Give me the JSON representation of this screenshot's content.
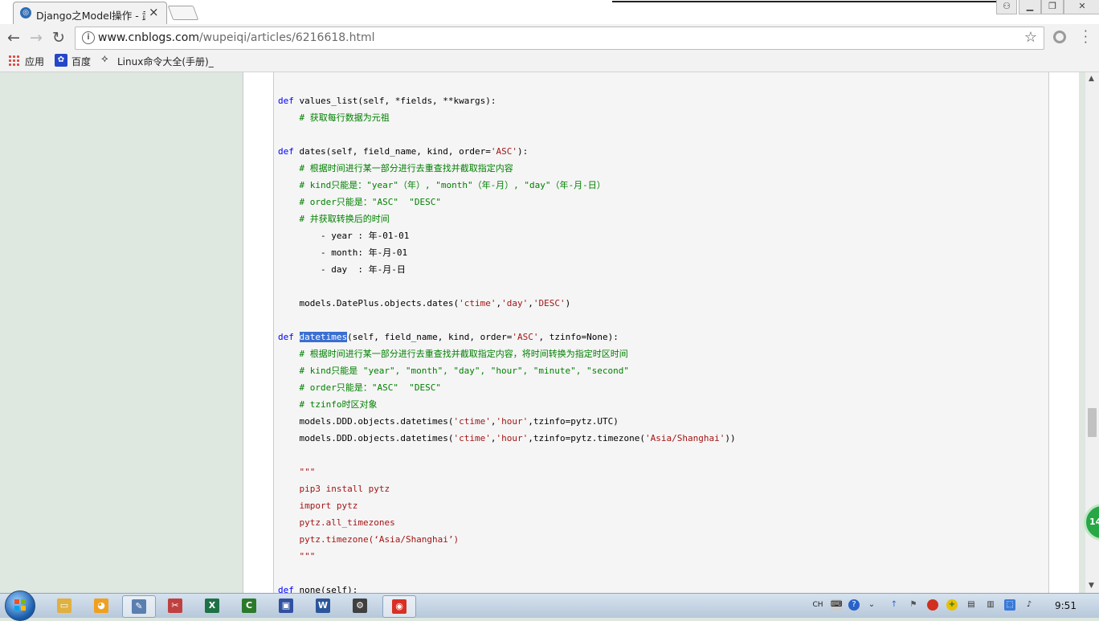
{
  "browser": {
    "tab": {
      "title": "Django之Model操作 - 武",
      "favicon": "cnblogs-icon"
    },
    "address": {
      "host": "www.cnblogs.com",
      "path": "/wupeiqi/articles/6216618.html"
    },
    "bookmarks": [
      {
        "label": "应用",
        "icon": "apps-icon"
      },
      {
        "label": "百度",
        "icon": "baidu-paw-icon"
      },
      {
        "label": "Linux命令大全(手册)_",
        "icon": "linux-bookmark-icon"
      }
    ]
  },
  "code": {
    "lines": [
      [
        {
          "c": "kw",
          "t": "def"
        },
        {
          "c": "",
          "t": " values_list(self, *fields, **kwargs):"
        }
      ],
      [
        {
          "c": "cm",
          "t": "    # 获取每行数据为元祖"
        }
      ],
      [],
      [
        {
          "c": "kw",
          "t": "def"
        },
        {
          "c": "",
          "t": " dates(self, field_name, kind, order="
        },
        {
          "c": "st",
          "t": "'ASC'"
        },
        {
          "c": "",
          "t": "):"
        }
      ],
      [
        {
          "c": "cm",
          "t": "    # 根据时间进行某一部分进行去重查找并截取指定内容"
        }
      ],
      [
        {
          "c": "cm",
          "t": "    # kind只能是：\"year\"（年）, \"month\"（年-月）, \"day\"（年-月-日）"
        }
      ],
      [
        {
          "c": "cm",
          "t": "    # order只能是：\"ASC\"  \"DESC\""
        }
      ],
      [
        {
          "c": "cm",
          "t": "    # 并获取转换后的时间"
        }
      ],
      [
        {
          "c": "",
          "t": "        - year : 年-01-01"
        }
      ],
      [
        {
          "c": "",
          "t": "        - month: 年-月-01"
        }
      ],
      [
        {
          "c": "",
          "t": "        - day  : 年-月-日"
        }
      ],
      [],
      [
        {
          "c": "",
          "t": "    models.DatePlus.objects.dates("
        },
        {
          "c": "st",
          "t": "'ctime'"
        },
        {
          "c": "",
          "t": ","
        },
        {
          "c": "st",
          "t": "'day'"
        },
        {
          "c": "",
          "t": ","
        },
        {
          "c": "st",
          "t": "'DESC'"
        },
        {
          "c": "",
          "t": ")"
        }
      ],
      [],
      [
        {
          "c": "kw",
          "t": "def"
        },
        {
          "c": "",
          "t": " "
        },
        {
          "c": "sel",
          "t": "datetimes"
        },
        {
          "c": "",
          "t": "(self, field_name, kind, order="
        },
        {
          "c": "st",
          "t": "'ASC'"
        },
        {
          "c": "",
          "t": ", tzinfo=None):"
        }
      ],
      [
        {
          "c": "cm",
          "t": "    # 根据时间进行某一部分进行去重查找并截取指定内容，将时间转换为指定时区时间"
        }
      ],
      [
        {
          "c": "cm",
          "t": "    # kind只能是 \"year\", \"month\", \"day\", \"hour\", \"minute\", \"second\""
        }
      ],
      [
        {
          "c": "cm",
          "t": "    # order只能是：\"ASC\"  \"DESC\""
        }
      ],
      [
        {
          "c": "cm",
          "t": "    # tzinfo时区对象"
        }
      ],
      [
        {
          "c": "",
          "t": "    models.DDD.objects.datetimes("
        },
        {
          "c": "st",
          "t": "'ctime'"
        },
        {
          "c": "",
          "t": ","
        },
        {
          "c": "st",
          "t": "'hour'"
        },
        {
          "c": "",
          "t": ",tzinfo=pytz.UTC)"
        }
      ],
      [
        {
          "c": "",
          "t": "    models.DDD.objects.datetimes("
        },
        {
          "c": "st",
          "t": "'ctime'"
        },
        {
          "c": "",
          "t": ","
        },
        {
          "c": "st",
          "t": "'hour'"
        },
        {
          "c": "",
          "t": ",tzinfo=pytz.timezone("
        },
        {
          "c": "st",
          "t": "'Asia/Shanghai'"
        },
        {
          "c": "",
          "t": "))"
        }
      ],
      [],
      [
        {
          "c": "st",
          "t": "    \"\"\""
        }
      ],
      [
        {
          "c": "st",
          "t": "    pip3 install pytz"
        }
      ],
      [
        {
          "c": "st",
          "t": "    import pytz"
        }
      ],
      [
        {
          "c": "st",
          "t": "    pytz.all_timezones"
        }
      ],
      [
        {
          "c": "st",
          "t": "    pytz.timezone(‘Asia/Shanghai’)"
        }
      ],
      [
        {
          "c": "st",
          "t": "    \"\"\""
        }
      ],
      [],
      [
        {
          "c": "kw",
          "t": "def"
        },
        {
          "c": "",
          "t": " none(self):"
        }
      ]
    ]
  },
  "float_badge": {
    "text": "14"
  },
  "taskbar": {
    "apps": [
      {
        "name": "explorer-icon",
        "glyph": "▭",
        "color": "#e0b040"
      },
      {
        "name": "paint-icon",
        "glyph": "◕",
        "color": "#f0a020"
      },
      {
        "name": "notepad-icon",
        "glyph": "✎",
        "color": "#5a7fb0"
      },
      {
        "name": "tool-icon",
        "glyph": "✂",
        "color": "#c04040"
      },
      {
        "name": "excel-icon",
        "glyph": "X",
        "color": "#1e7145"
      },
      {
        "name": "camtasia-icon",
        "glyph": "C",
        "color": "#2a7a2a"
      },
      {
        "name": "save-app-icon",
        "glyph": "▣",
        "color": "#3050a0"
      },
      {
        "name": "word-icon",
        "glyph": "W",
        "color": "#2b579a"
      },
      {
        "name": "settings-app-icon",
        "glyph": "⚙",
        "color": "#404040"
      },
      {
        "name": "chrome-icon",
        "glyph": "◉",
        "color": "#d93025"
      }
    ],
    "tray_lang": "CH",
    "clock": "9:51"
  }
}
